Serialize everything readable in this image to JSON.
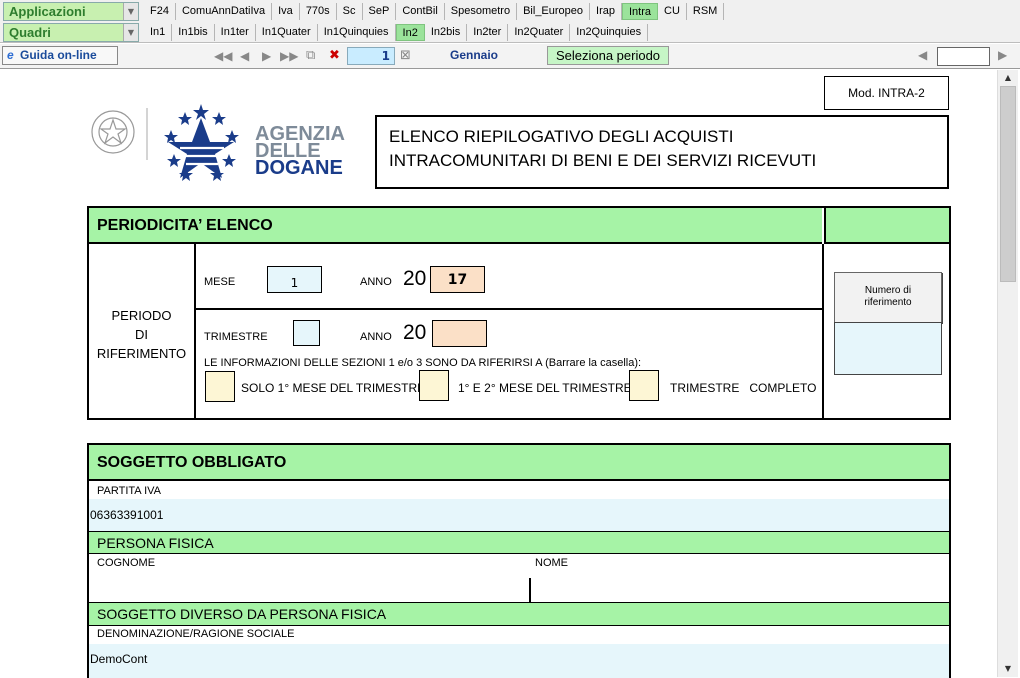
{
  "menu": {
    "applicazioni_label": "Applicazioni",
    "quadri_label": "Quadri",
    "apps": [
      "F24",
      "ComuAnnDatiIva",
      "Iva",
      "770s",
      "Sc",
      "SeP",
      "ContBil",
      "Spesometro",
      "Bil_Europeo",
      "Irap",
      "Intra",
      "CU",
      "RSM"
    ],
    "apps_selected": "Intra",
    "quadri": [
      "In1",
      "In1bis",
      "In1ter",
      "In1Quater",
      "In1Quinquies",
      "In2",
      "In2bis",
      "In2ter",
      "In2Quater",
      "In2Quinquies"
    ],
    "quadri_selected": "In2"
  },
  "nav": {
    "guida": "Guida on-line",
    "page": "1",
    "month": "Gennaio",
    "seleziona": "Seleziona periodo"
  },
  "form": {
    "modello": "Mod. INTRA-2",
    "logo": {
      "line1": "AGENZIA",
      "line2": "DELLE",
      "line3": "DOGANE"
    },
    "title_line1": "ELENCO RIEPILOGATIVO DEGLI ACQUISTI",
    "title_line2": "INTRACOMUNITARI DI BENI E DEI SERVIZI RICEVUTI",
    "periodicita": {
      "header": "PERIODICITA’ ELENCO",
      "periodo_l1": "PERIODO",
      "periodo_l2": "DI",
      "periodo_l3": "RIFERIMENTO",
      "mese_label": "MESE",
      "mese_value": "1",
      "anno_label": "ANNO",
      "anno_prefix": "20",
      "anno_value": "17",
      "trimestre_label": "TRIMESTRE",
      "anno2_label": "ANNO",
      "anno2_prefix": "20",
      "info_text": "LE INFORMAZIONI DELLE SEZIONI 1 e/o 3 SONO DA RIFERIRSI A (Barrare la casella):",
      "opt1": "SOLO 1° MESE DEL TRIMESTRE",
      "opt2": "1° E 2° MESE DEL TRIMESTRE",
      "opt3": "TRIMESTRE   COMPLETO",
      "numero_rif": "Numero di riferimento"
    },
    "soggetto": {
      "header": "SOGGETTO OBBLIGATO",
      "partita_iva_label": "PARTITA IVA",
      "partita_iva_value": "06363391001",
      "persona_fisica": "PERSONA FISICA",
      "cognome_label": "COGNOME",
      "nome_label": "NOME",
      "diverso": "SOGGETTO DIVERSO DA PERSONA FISICA",
      "denominazione_label": "DENOMINAZIONE/RAGIONE SOCIALE",
      "denominazione_value": "DemoCont"
    }
  }
}
